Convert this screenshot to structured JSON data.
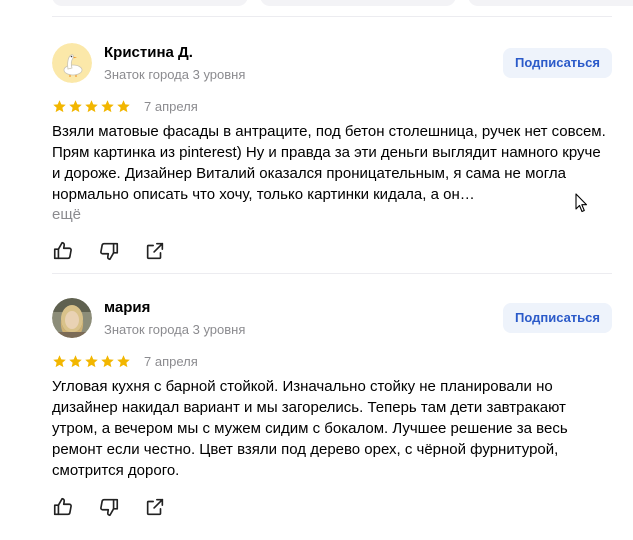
{
  "colors": {
    "star": "#f2b600",
    "subscribe_bg": "#eef3fb",
    "subscribe_text": "#2b5ac9",
    "muted_text": "#8b8b8f"
  },
  "reviews": [
    {
      "author": "Кристина Д.",
      "level": "Знаток города 3 уровня",
      "subscribe_label": "Подписаться",
      "rating": 5,
      "date": "7 апреля",
      "text": "Взяли матовые фасады в антраците, под бетон столешница, ручек нет совсем. Прям картинка из pinterest) Ну и правда за эти деньги выглядит намного круче и дороже. Дизайнер Виталий оказался проницательным, я сама не могла нормально описать что хочу, только картинки кидала, а он…",
      "more_label": "ещё",
      "avatar_icon": "goose-avatar-icon"
    },
    {
      "author": "мария",
      "level": "Знаток города 3 уровня",
      "subscribe_label": "Подписаться",
      "rating": 5,
      "date": "7 апреля",
      "text": "Угловая кухня с барной стойкой. Изначально стойку не планировали но дизайнер накидал вариант и мы загорелись. Теперь там дети завтракают утром, а вечером мы с мужем сидим с бокалом. Лучшее решение за весь ремонт если честно. Цвет взяли под дерево орех, с чёрной фурнитурой, смотрится дорого.",
      "avatar_icon": "user-photo-avatar"
    }
  ],
  "actions": [
    "thumb-up-icon",
    "thumb-down-icon",
    "share-icon"
  ]
}
